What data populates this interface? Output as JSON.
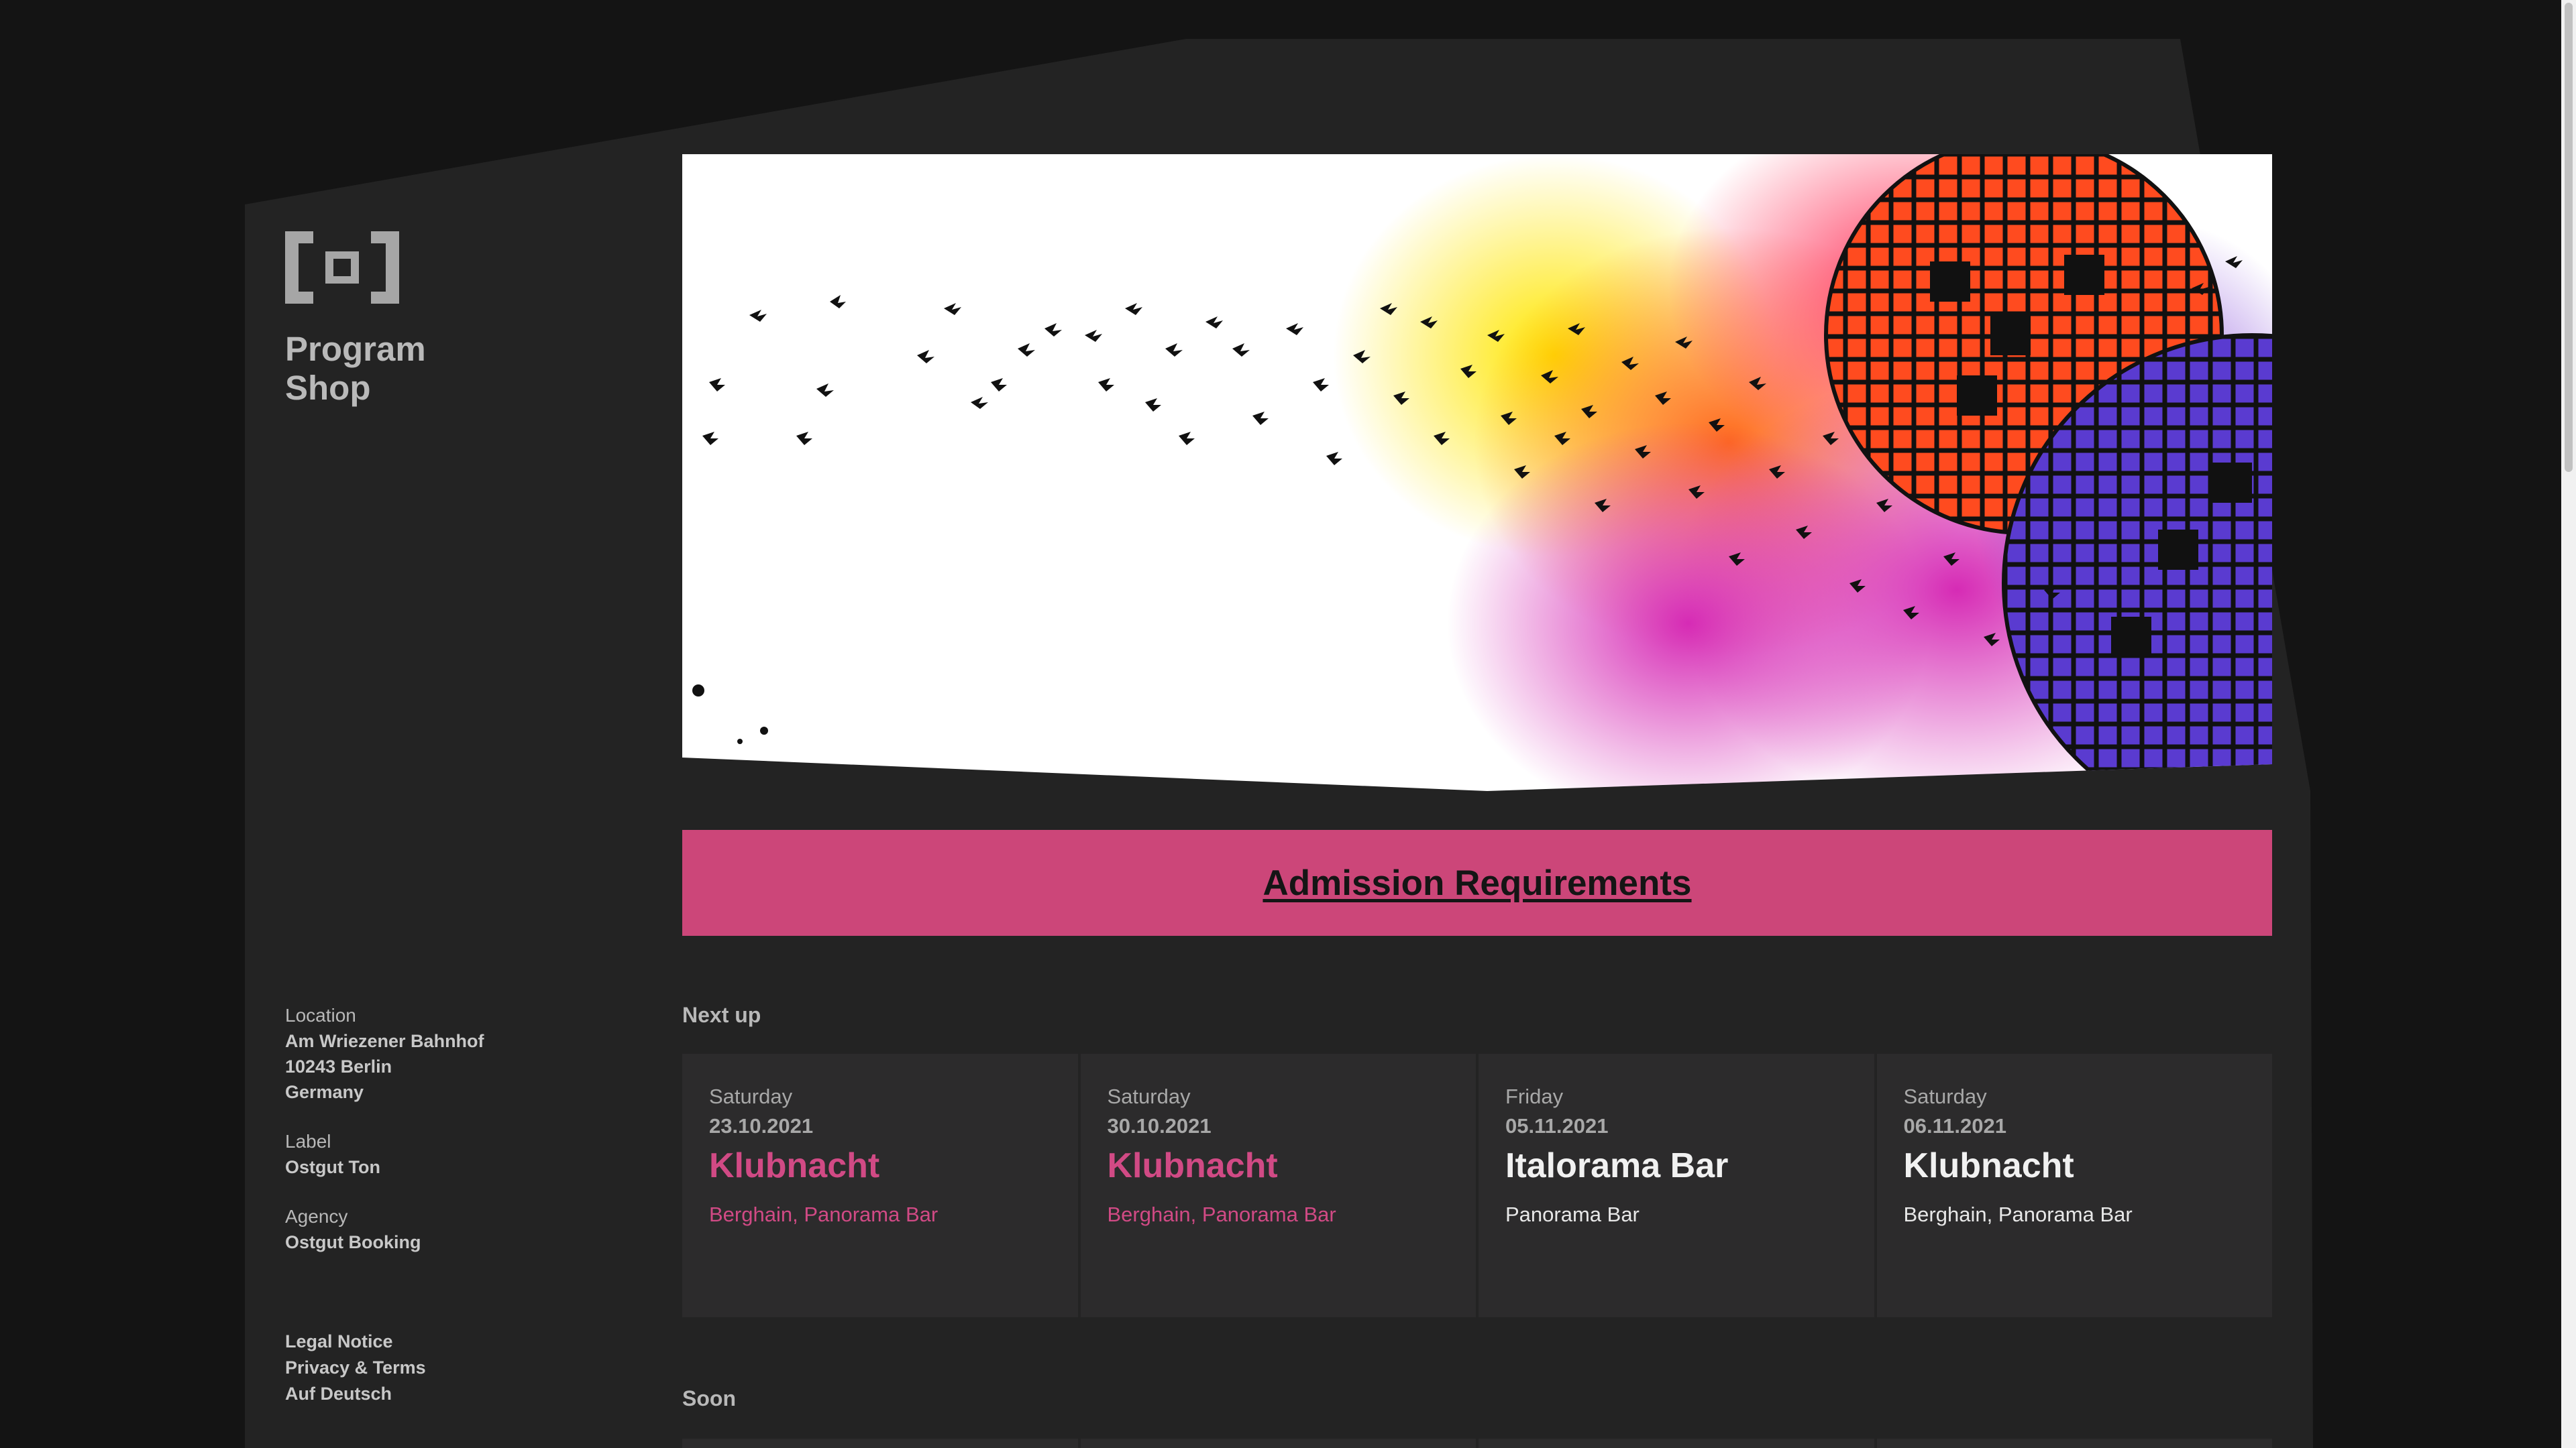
{
  "sidebar": {
    "nav": [
      {
        "label": "Program"
      },
      {
        "label": "Shop"
      }
    ],
    "location": {
      "label": "Location",
      "lines": [
        "Am Wriezener Bahnhof",
        "10243 Berlin",
        "Germany"
      ]
    },
    "record_label": {
      "label": "Label",
      "value": "Ostgut Ton"
    },
    "agency": {
      "label": "Agency",
      "value": "Ostgut Booking"
    },
    "legal": [
      {
        "label": "Legal Notice"
      },
      {
        "label": "Privacy & Terms"
      },
      {
        "label": "Auf Deutsch"
      }
    ]
  },
  "banner": {
    "label": "Admission Requirements"
  },
  "next_up": {
    "heading": "Next up",
    "events": [
      {
        "day": "Saturday",
        "date": "23.10.2021",
        "title": "Klubnacht",
        "venue": "Berghain, Panorama Bar",
        "accent": true
      },
      {
        "day": "Saturday",
        "date": "30.10.2021",
        "title": "Klubnacht",
        "venue": "Berghain, Panorama Bar",
        "accent": true
      },
      {
        "day": "Friday",
        "date": "05.11.2021",
        "title": "Italorama Bar",
        "venue": "Panorama Bar",
        "accent": false
      },
      {
        "day": "Saturday",
        "date": "06.11.2021",
        "title": "Klubnacht",
        "venue": "Berghain, Panorama Bar",
        "accent": false
      }
    ]
  },
  "soon": {
    "heading": "Soon"
  },
  "colors": {
    "background": "#141414",
    "panel": "#232323",
    "card": "#2c2b2c",
    "accent": "#cc4679",
    "accent_text": "#d14a85"
  },
  "icons": [
    "berghain-logo-icon",
    "hero-artwork"
  ]
}
